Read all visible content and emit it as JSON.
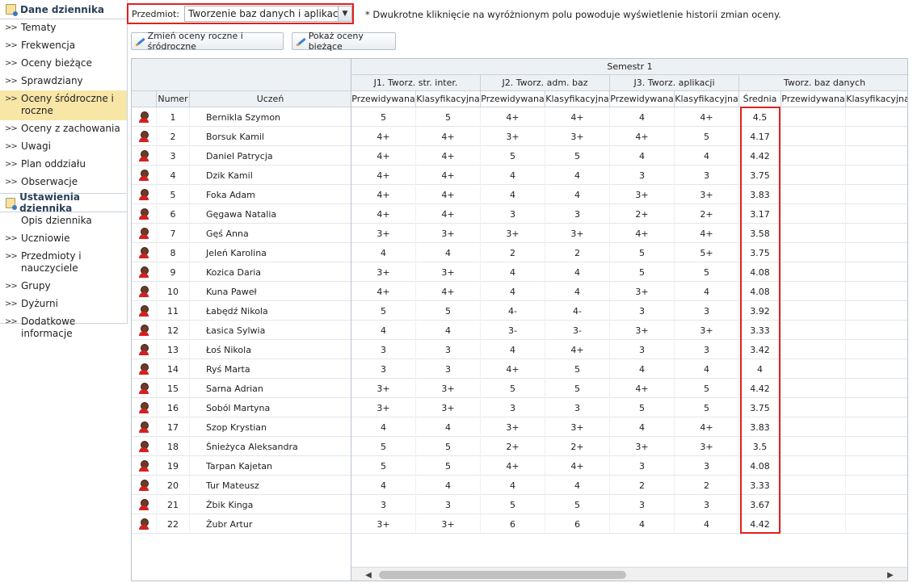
{
  "sidebar": {
    "section1_title": "Dane dziennika",
    "section1_items": [
      {
        "label": "Tematy"
      },
      {
        "label": "Frekwencja"
      },
      {
        "label": "Oceny bieżące"
      },
      {
        "label": "Sprawdziany"
      },
      {
        "label": "Oceny śródroczne i roczne",
        "active": true
      },
      {
        "label": "Oceny z zachowania"
      },
      {
        "label": "Uwagi"
      },
      {
        "label": "Plan oddziału"
      },
      {
        "label": "Obserwacje"
      }
    ],
    "section2_title": "Ustawienia dziennika",
    "section2_items": [
      {
        "label": "Opis dziennika",
        "arrow": false
      },
      {
        "label": "Uczniowie"
      },
      {
        "label": "Przedmioty i nauczyciele"
      },
      {
        "label": "Grupy"
      },
      {
        "label": "Dyżurni"
      },
      {
        "label": "Dodatkowe informacje"
      }
    ],
    "arrow_glyph": ">>"
  },
  "toolbar": {
    "subject_label": "Przedmiot:",
    "subject_value": "Tworzenie baz danych i aplikacji inte",
    "dropdown_glyph": "▼",
    "hint": "* Dwukrotne kliknięcie na wyróżnionym polu powoduje wyświetlenie historii zmian oceny.",
    "change_button": "Zmień oceny roczne i śródroczne",
    "show_button": "Pokaż oceny bieżące"
  },
  "grid": {
    "semester": "Semestr 1",
    "col_number": "Numer",
    "col_student": "Uczeń",
    "groups": [
      "J1. Tworz. str. inter.",
      "J2. Tworz. adm. baz",
      "J3. Tworz. aplikacji",
      "Tworz. baz danych"
    ],
    "sub_predicted": "Przewidywana",
    "sub_classified": "Klasyfikacyjna",
    "sub_average": "Średnia",
    "rows": [
      {
        "num": "1",
        "name": "Bernikla Szymon",
        "g": [
          "5",
          "5",
          "4+",
          "4+",
          "4",
          "4+"
        ],
        "avg": "4.5"
      },
      {
        "num": "2",
        "name": "Borsuk Kamil",
        "g": [
          "4+",
          "4+",
          "3+",
          "3+",
          "4+",
          "5"
        ],
        "avg": "4.17"
      },
      {
        "num": "3",
        "name": "Daniel Patrycja",
        "g": [
          "4+",
          "4+",
          "5",
          "5",
          "4",
          "4"
        ],
        "avg": "4.42"
      },
      {
        "num": "4",
        "name": "Dzik Kamil",
        "g": [
          "4+",
          "4+",
          "4",
          "4",
          "3",
          "3"
        ],
        "avg": "3.75"
      },
      {
        "num": "5",
        "name": "Foka Adam",
        "g": [
          "4+",
          "4+",
          "4",
          "4",
          "3+",
          "3+"
        ],
        "avg": "3.83"
      },
      {
        "num": "6",
        "name": "Gęgawa Natalia",
        "g": [
          "4+",
          "4+",
          "3",
          "3",
          "2+",
          "2+"
        ],
        "avg": "3.17"
      },
      {
        "num": "7",
        "name": "Gęś Anna",
        "g": [
          "3+",
          "3+",
          "3+",
          "3+",
          "4+",
          "4+"
        ],
        "avg": "3.58"
      },
      {
        "num": "8",
        "name": "Jeleń Karolina",
        "g": [
          "4",
          "4",
          "2",
          "2",
          "5",
          "5+"
        ],
        "avg": "3.75"
      },
      {
        "num": "9",
        "name": "Kozica Daria",
        "g": [
          "3+",
          "3+",
          "4",
          "4",
          "5",
          "5"
        ],
        "avg": "4.08"
      },
      {
        "num": "10",
        "name": "Kuna Paweł",
        "g": [
          "4+",
          "4+",
          "4",
          "4",
          "3+",
          "4"
        ],
        "avg": "4.08"
      },
      {
        "num": "11",
        "name": "Łabędź Nikola",
        "g": [
          "5",
          "5",
          "4-",
          "4-",
          "3",
          "3"
        ],
        "avg": "3.92"
      },
      {
        "num": "12",
        "name": "Łasica Sylwia",
        "g": [
          "4",
          "4",
          "3-",
          "3-",
          "3+",
          "3+"
        ],
        "avg": "3.33"
      },
      {
        "num": "13",
        "name": "Łoś Nikola",
        "g": [
          "3",
          "3",
          "4",
          "4+",
          "3",
          "3"
        ],
        "avg": "3.42"
      },
      {
        "num": "14",
        "name": "Ryś Marta",
        "g": [
          "3",
          "3",
          "4+",
          "5",
          "4",
          "4"
        ],
        "avg": "4"
      },
      {
        "num": "15",
        "name": "Sarna Adrian",
        "g": [
          "3+",
          "3+",
          "5",
          "5",
          "4+",
          "5"
        ],
        "avg": "4.42"
      },
      {
        "num": "16",
        "name": "Soból Martyna",
        "g": [
          "3+",
          "3+",
          "3",
          "3",
          "5",
          "5"
        ],
        "avg": "3.75"
      },
      {
        "num": "17",
        "name": "Szop Krystian",
        "g": [
          "4",
          "4",
          "3+",
          "3+",
          "4",
          "4+"
        ],
        "avg": "3.83"
      },
      {
        "num": "18",
        "name": "Śnieżyca Aleksandra",
        "g": [
          "5",
          "5",
          "2+",
          "2+",
          "3+",
          "3+"
        ],
        "avg": "3.5"
      },
      {
        "num": "19",
        "name": "Tarpan Kajetan",
        "g": [
          "5",
          "5",
          "4+",
          "4+",
          "3",
          "3"
        ],
        "avg": "4.08"
      },
      {
        "num": "20",
        "name": "Tur Mateusz",
        "g": [
          "4",
          "4",
          "4",
          "4",
          "2",
          "2"
        ],
        "avg": "3.33"
      },
      {
        "num": "21",
        "name": "Żbik Kinga",
        "g": [
          "3",
          "3",
          "5",
          "5",
          "3",
          "3"
        ],
        "avg": "3.67"
      },
      {
        "num": "22",
        "name": "Żubr Artur",
        "g": [
          "3+",
          "3+",
          "6",
          "6",
          "4",
          "4"
        ],
        "avg": "4.42"
      }
    ],
    "scroll_left_glyph": "◀",
    "scroll_right_glyph": "▶"
  }
}
